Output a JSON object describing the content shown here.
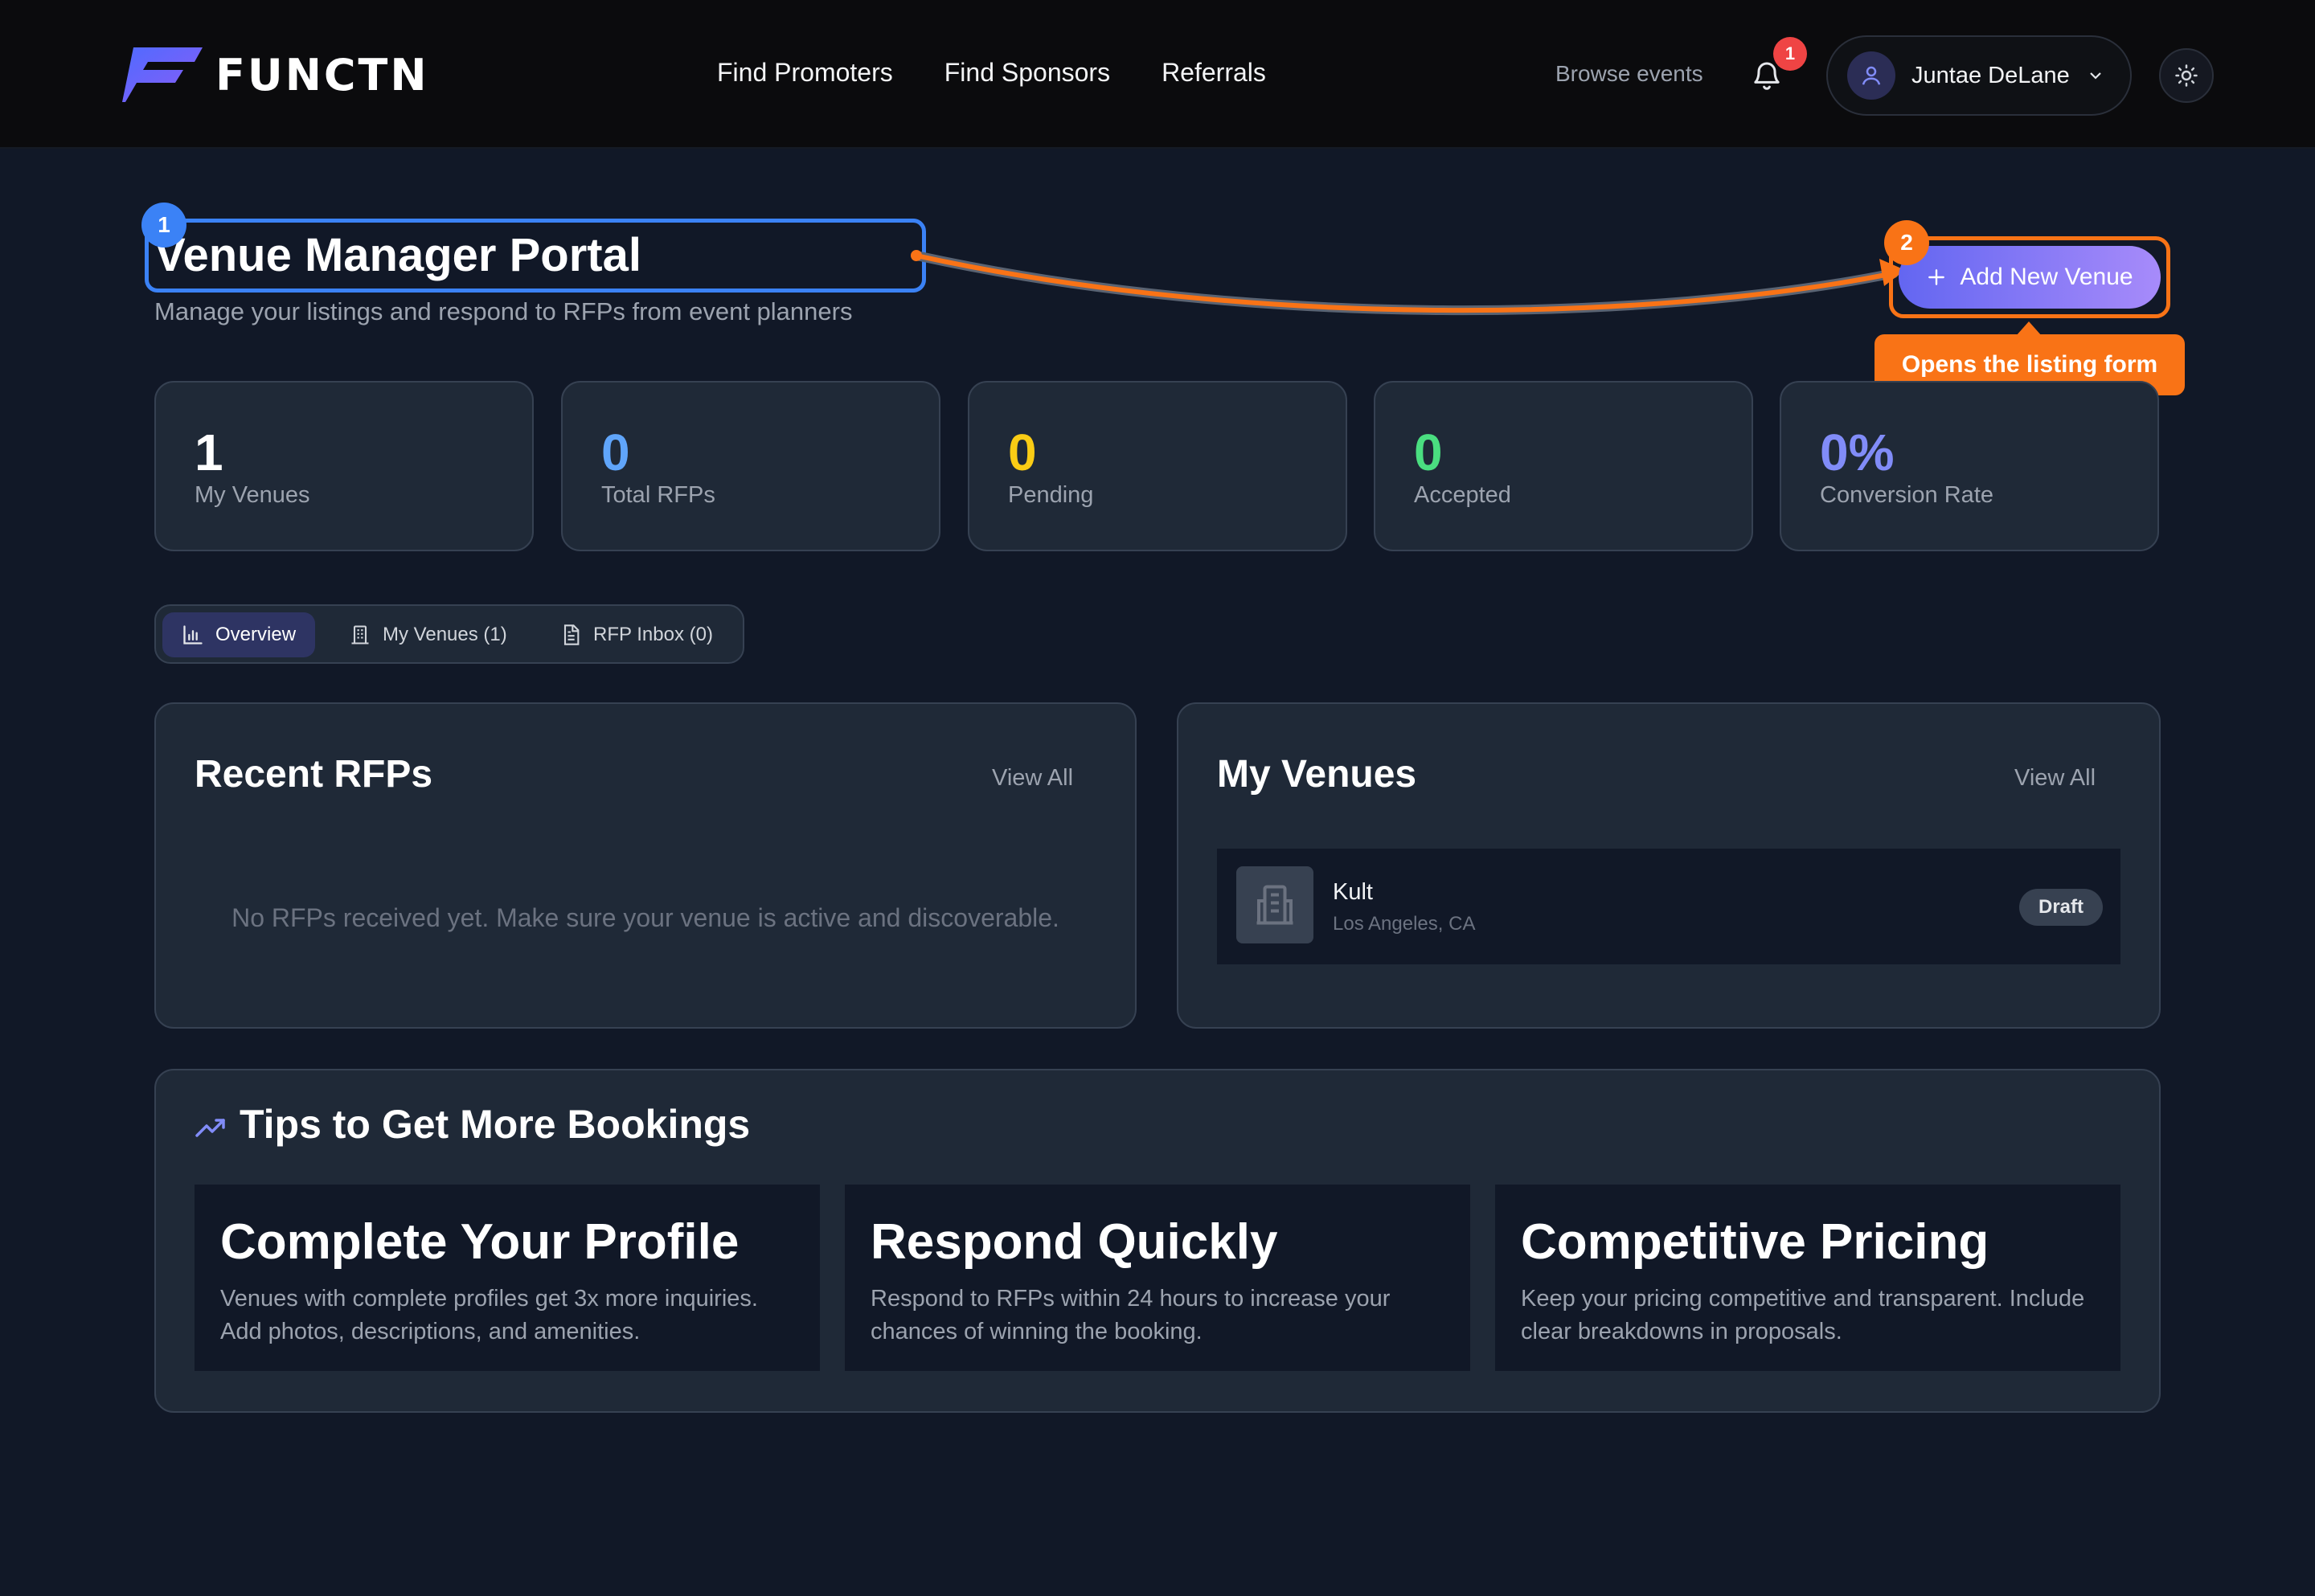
{
  "brand": {
    "name": "FUNCTN"
  },
  "nav": {
    "links": [
      "Find Promoters",
      "Find Sponsors",
      "Referrals"
    ],
    "browse": "Browse events",
    "notifications_count": "1",
    "user_name": "Juntae DeLane"
  },
  "header": {
    "title": "Venue Manager Portal",
    "subtitle": "Manage your listings and respond to RFPs from event planners",
    "add_button": "Add New Venue"
  },
  "annotations": {
    "step1": "1",
    "step2": "2",
    "tooltip": "Opens the listing form",
    "color": "#f97316",
    "highlight_color": "#3b82f6"
  },
  "stats": [
    {
      "value": "1",
      "label": "My Venues",
      "color": "#ffffff"
    },
    {
      "value": "0",
      "label": "Total RFPs",
      "color": "#60a5fa"
    },
    {
      "value": "0",
      "label": "Pending",
      "color": "#facc15"
    },
    {
      "value": "0",
      "label": "Accepted",
      "color": "#4ade80"
    },
    {
      "value": "0%",
      "label": "Conversion Rate",
      "color": "#818cf8"
    }
  ],
  "tabs": [
    {
      "label": "Overview",
      "icon": "bar-chart-icon",
      "active": true
    },
    {
      "label": "My Venues (1)",
      "icon": "building-icon",
      "active": false
    },
    {
      "label": "RFP Inbox (0)",
      "icon": "document-icon",
      "active": false
    }
  ],
  "recent_rfps": {
    "title": "Recent RFPs",
    "view_all": "View All",
    "empty": "No RFPs received yet. Make sure your venue is active and discoverable."
  },
  "my_venues": {
    "title": "My Venues",
    "view_all": "View All",
    "items": [
      {
        "name": "Kult",
        "location": "Los Angeles, CA",
        "status": "Draft"
      }
    ]
  },
  "tips": {
    "title": "Tips to Get More Bookings",
    "cards": [
      {
        "title": "Complete Your Profile",
        "desc": "Venues with complete profiles get 3x more inquiries. Add photos, descriptions, and amenities."
      },
      {
        "title": "Respond Quickly",
        "desc": "Respond to RFPs within 24 hours to increase your chances of winning the booking."
      },
      {
        "title": "Competitive Pricing",
        "desc": "Keep your pricing competitive and transparent. Include clear breakdowns in proposals."
      }
    ]
  }
}
